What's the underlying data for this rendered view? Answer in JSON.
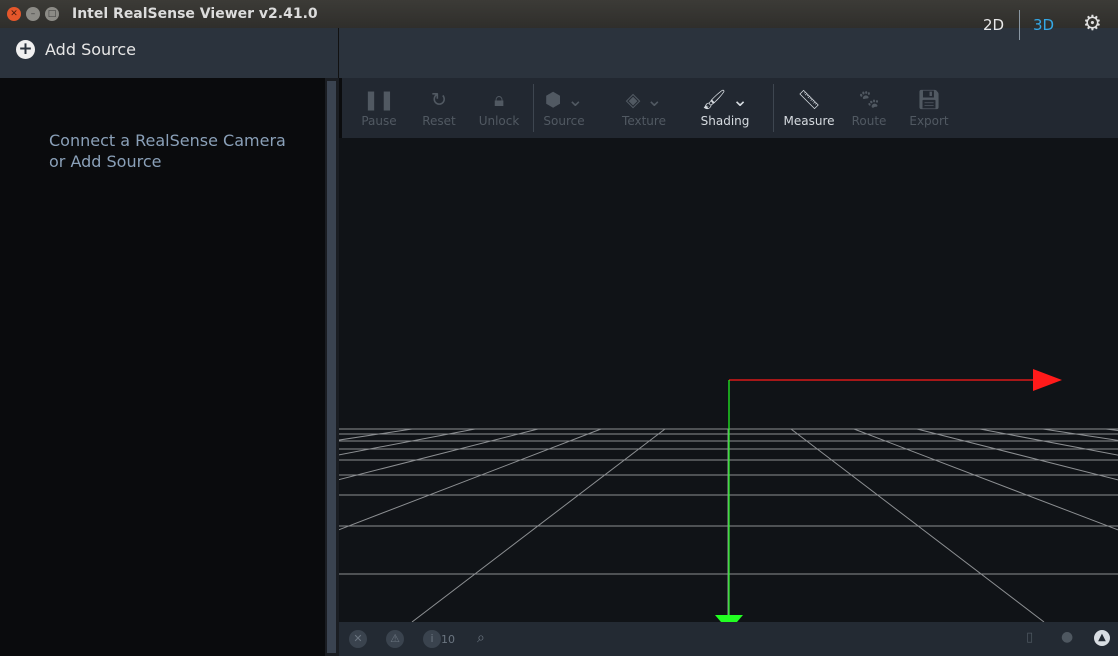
{
  "window": {
    "title": "Intel RealSense Viewer v2.41.0"
  },
  "sidebar": {
    "add_source_label": "Add Source",
    "hint_line1": "Connect a RealSense Camera",
    "hint_line2": "or Add Source"
  },
  "view_toggle": {
    "mode_2d": "2D",
    "mode_3d": "3D",
    "active": "3D"
  },
  "toolbar": {
    "pause": "Pause",
    "reset": "Reset",
    "unlock": "Unlock",
    "source": "Source",
    "texture": "Texture",
    "shading": "Shading",
    "measure": "Measure",
    "route": "Route",
    "export": "Export"
  },
  "statusbar": {
    "info_count": "10"
  },
  "colors": {
    "accent": "#34a8e6",
    "axis_x": "#ff1a1a",
    "axis_y": "#22ff22",
    "grid": "#8c8f92"
  }
}
